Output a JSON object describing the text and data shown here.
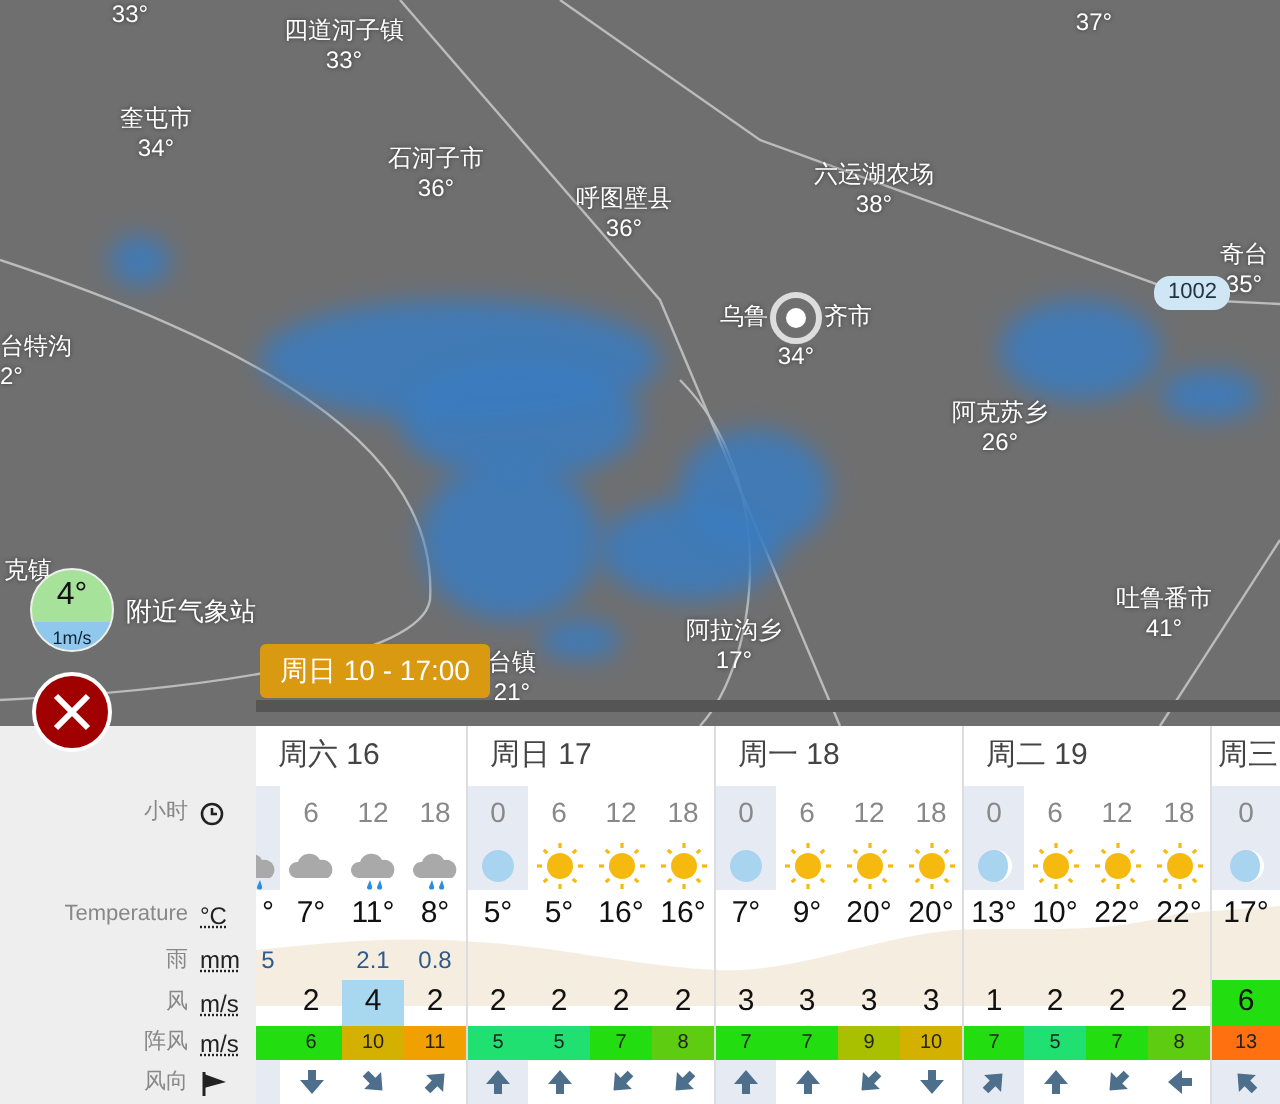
{
  "map": {
    "places": [
      {
        "temp": "33°"
      },
      {
        "name": "四道河子镇",
        "temp": "33°"
      },
      {
        "temp": "37°"
      },
      {
        "name": "奎屯市",
        "temp": "34°"
      },
      {
        "name": "石河子市",
        "temp": "36°"
      },
      {
        "name": "呼图壁县",
        "temp": "36°"
      },
      {
        "name": "六运湖农场",
        "temp": "38°"
      },
      {
        "name": "奇台",
        "temp": "35°"
      },
      {
        "name": "台特沟",
        "temp": "2°"
      },
      {
        "name": "阿克苏乡",
        "temp": "26°"
      },
      {
        "name": "克镇"
      },
      {
        "name": "吐鲁番市",
        "temp": "41°"
      },
      {
        "name": "阿拉沟乡",
        "temp": "17°"
      },
      {
        "name": "台镇",
        "temp": "21°"
      }
    ],
    "city": {
      "name_left": "乌鲁",
      "name_right": "齐市",
      "temp": "34°"
    },
    "road_badge": "1002",
    "station": {
      "temp": "4°",
      "wind": "1m/s",
      "label": "附近气象站"
    },
    "time_badge": "周日 10 - 17:00"
  },
  "table": {
    "labels": [
      {
        "kind": "hour",
        "text": "小时"
      },
      {
        "kind": "icon"
      },
      {
        "kind": "temp",
        "text": "Temperature",
        "unit": "°C"
      },
      {
        "kind": "rain",
        "text": "雨",
        "unit": "mm"
      },
      {
        "kind": "wind",
        "text": "风",
        "unit": "m/s"
      },
      {
        "kind": "gust",
        "text": "阵风",
        "unit": "m/s"
      },
      {
        "kind": "dir",
        "text": "风向"
      }
    ],
    "days": [
      {
        "label": "周六 16",
        "columns": [
          {
            "night": true,
            "icon": {
              "kind": "rain-cloud"
            },
            "temp": "°",
            "rain": "5",
            "gust": {
              "color": "#22dd10"
            }
          },
          {
            "hour": "6",
            "night": false,
            "icon": {
              "kind": "cloud"
            },
            "temp": "7°",
            "wind": {
              "text": "2"
            },
            "gust": {
              "text": "6",
              "color": "#22dd10"
            },
            "arrow": {
              "kind": "down"
            }
          },
          {
            "hour": "12",
            "night": false,
            "icon": {
              "kind": "rain-cloud"
            },
            "temp": "11°",
            "rain": "2.1",
            "wind": {
              "text": "4",
              "color": "#a8d8f0"
            },
            "gust": {
              "text": "10",
              "color": "#d4b000"
            },
            "arrow": {
              "kind": "down-right"
            }
          },
          {
            "hour": "18",
            "night": false,
            "icon": {
              "kind": "rain-cloud"
            },
            "temp": "8°",
            "rain": "0.8",
            "wind": {
              "text": "2"
            },
            "gust": {
              "text": "11",
              "color": "#f0a000"
            },
            "arrow": {
              "kind": "up-right"
            }
          }
        ]
      },
      {
        "label": "周日 17",
        "columns": [
          {
            "hour": "0",
            "night": true,
            "icon": {
              "kind": "moon-full"
            },
            "temp": "5°",
            "wind": {
              "text": "2"
            },
            "gust": {
              "text": "5",
              "color": "#1fe070"
            },
            "arrow": {
              "kind": "up"
            }
          },
          {
            "hour": "6",
            "night": false,
            "icon": {
              "kind": "sun"
            },
            "temp": "5°",
            "wind": {
              "text": "2"
            },
            "gust": {
              "text": "5",
              "color": "#1fe070"
            },
            "arrow": {
              "kind": "up"
            }
          },
          {
            "hour": "12",
            "night": false,
            "icon": {
              "kind": "sun"
            },
            "temp": "16°",
            "wind": {
              "text": "2"
            },
            "gust": {
              "text": "7",
              "color": "#22dd10"
            },
            "arrow": {
              "kind": "down-left"
            }
          },
          {
            "hour": "18",
            "night": false,
            "icon": {
              "kind": "sun"
            },
            "temp": "16°",
            "wind": {
              "text": "2"
            },
            "gust": {
              "text": "8",
              "color": "#5ecc10"
            },
            "arrow": {
              "kind": "down-left"
            }
          }
        ]
      },
      {
        "label": "周一 18",
        "columns": [
          {
            "hour": "0",
            "night": true,
            "icon": {
              "kind": "moon-full"
            },
            "temp": "7°",
            "wind": {
              "text": "3"
            },
            "gust": {
              "text": "7",
              "color": "#22dd10"
            },
            "arrow": {
              "kind": "up"
            }
          },
          {
            "hour": "6",
            "night": false,
            "icon": {
              "kind": "sun"
            },
            "temp": "9°",
            "wind": {
              "text": "3"
            },
            "gust": {
              "text": "7",
              "color": "#22dd10"
            },
            "arrow": {
              "kind": "up"
            }
          },
          {
            "hour": "12",
            "night": false,
            "icon": {
              "kind": "sun"
            },
            "temp": "20°",
            "wind": {
              "text": "3"
            },
            "gust": {
              "text": "9",
              "color": "#a8c000"
            },
            "arrow": {
              "kind": "down-left"
            }
          },
          {
            "hour": "18",
            "night": false,
            "icon": {
              "kind": "sun"
            },
            "temp": "20°",
            "wind": {
              "text": "3"
            },
            "gust": {
              "text": "10",
              "color": "#d4b000"
            },
            "arrow": {
              "kind": "down"
            }
          }
        ]
      },
      {
        "label": "周二 19",
        "columns": [
          {
            "hour": "0",
            "night": true,
            "icon": {
              "kind": "moon-crescent"
            },
            "temp": "13°",
            "wind": {
              "text": "1"
            },
            "gust": {
              "text": "7",
              "color": "#22dd10"
            },
            "arrow": {
              "kind": "up-right"
            }
          },
          {
            "hour": "6",
            "night": false,
            "icon": {
              "kind": "sun"
            },
            "temp": "10°",
            "wind": {
              "text": "2"
            },
            "gust": {
              "text": "5",
              "color": "#1fe070"
            },
            "arrow": {
              "kind": "up"
            }
          },
          {
            "hour": "12",
            "night": false,
            "icon": {
              "kind": "sun"
            },
            "temp": "22°",
            "wind": {
              "text": "2"
            },
            "gust": {
              "text": "7",
              "color": "#22dd10"
            },
            "arrow": {
              "kind": "down-left"
            }
          },
          {
            "hour": "18",
            "night": false,
            "icon": {
              "kind": "sun"
            },
            "temp": "22°",
            "wind": {
              "text": "2"
            },
            "gust": {
              "text": "8",
              "color": "#5ecc10"
            },
            "arrow": {
              "kind": "left"
            }
          }
        ]
      },
      {
        "label": "周三",
        "columns": [
          {
            "hour": "0",
            "night": true,
            "icon": {
              "kind": "moon-crescent"
            },
            "temp": "17°",
            "wind": {
              "text": "6",
              "color": "#22dd10"
            },
            "gust": {
              "text": "13",
              "color": "#ff7010"
            },
            "arrow": {
              "kind": "up-left"
            }
          }
        ]
      }
    ]
  }
}
